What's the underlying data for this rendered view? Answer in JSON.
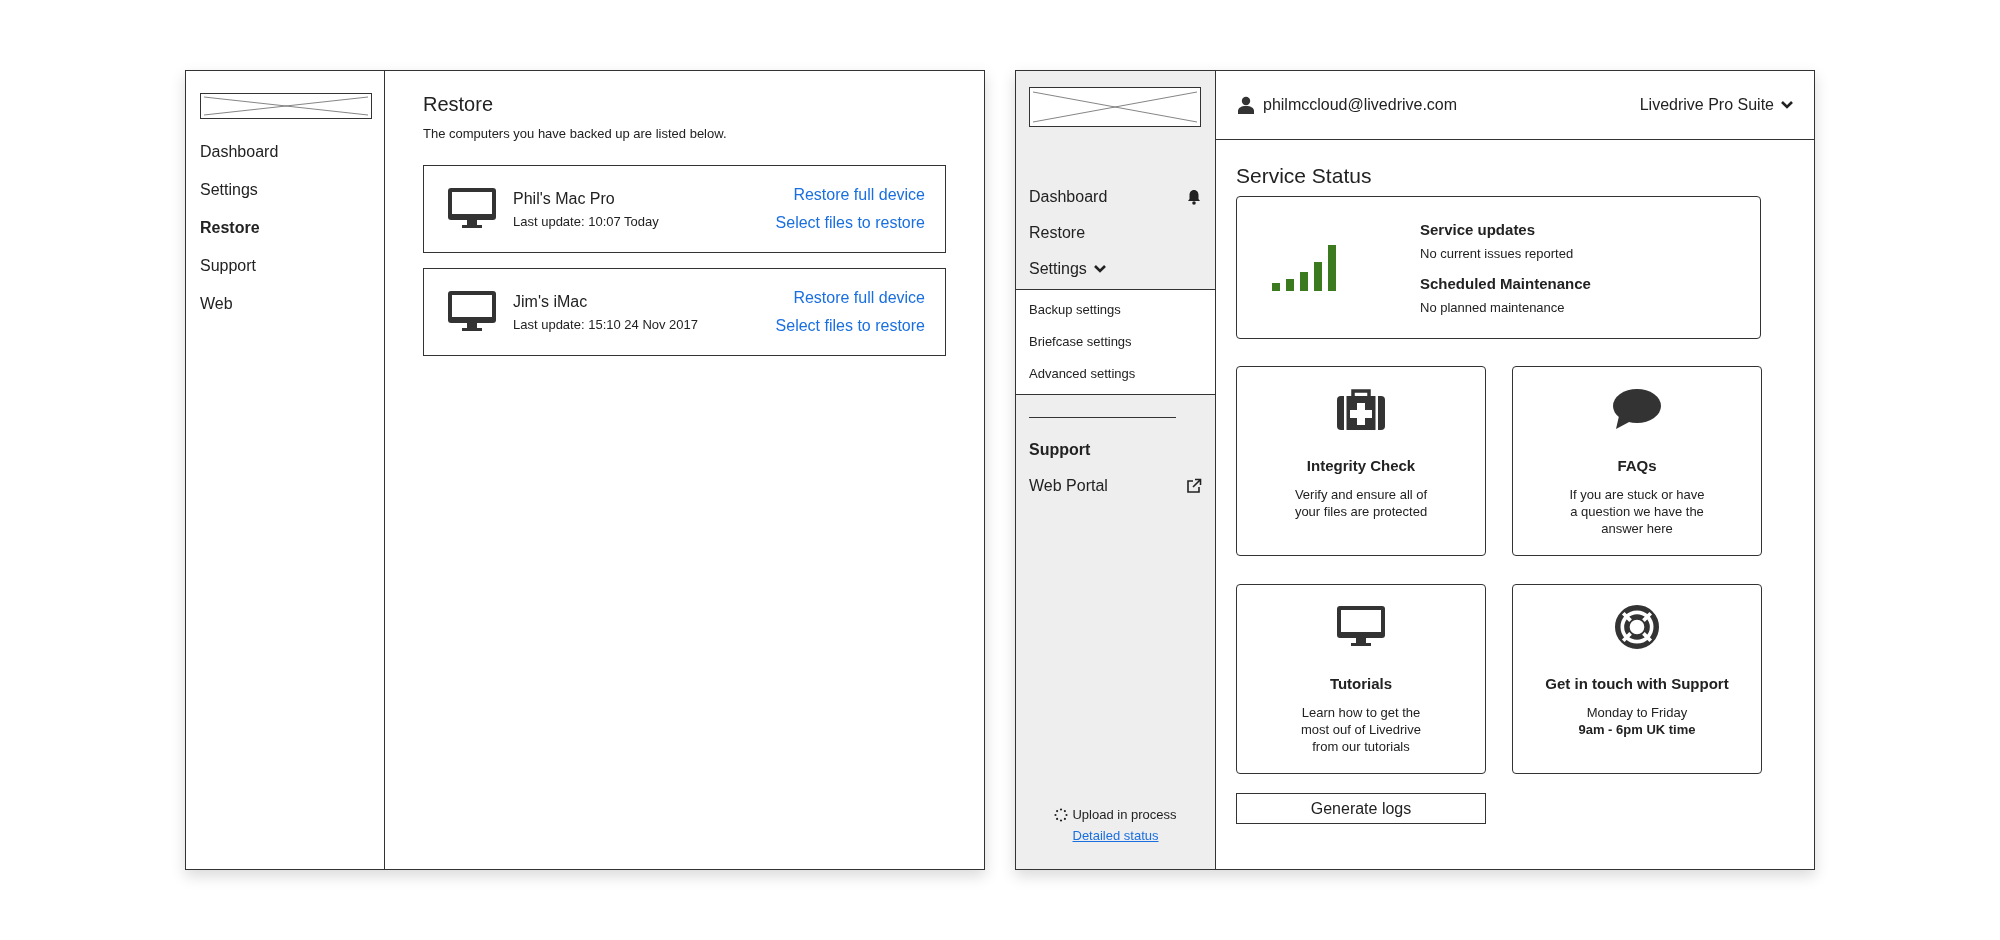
{
  "restore_window": {
    "sidebar": {
      "items": [
        {
          "label": "Dashboard",
          "selected": false
        },
        {
          "label": "Settings",
          "selected": false
        },
        {
          "label": "Restore",
          "selected": true
        },
        {
          "label": "Support",
          "selected": false
        },
        {
          "label": "Web",
          "selected": false
        }
      ]
    },
    "title": "Restore",
    "subtitle": "The computers you have backed up are listed below.",
    "devices": [
      {
        "name": "Phil's Mac Pro",
        "last_update": "Last update: 10:07 Today",
        "actions": [
          "Restore full device",
          "Select files to restore"
        ]
      },
      {
        "name": "Jim's iMac",
        "last_update": "Last update: 15:10 24 Nov 2017",
        "actions": [
          "Restore full device",
          "Select files to restore"
        ]
      }
    ]
  },
  "dashboard_window": {
    "sidebar": {
      "items": [
        {
          "label": "Dashboard",
          "kind": "alert",
          "selected": false
        },
        {
          "label": "Restore",
          "kind": "plain",
          "selected": false
        },
        {
          "label": "Settings",
          "kind": "group",
          "selected": false,
          "expanded": true,
          "children": [
            {
              "label": "Backup settings"
            },
            {
              "label": "Briefcase settings"
            },
            {
              "label": "Advanced settings"
            }
          ]
        },
        {
          "label": "Support",
          "kind": "plain",
          "selected": true
        },
        {
          "label": "Web Portal",
          "kind": "external",
          "selected": false
        }
      ],
      "upload_status": "Upload in process",
      "status_link": "Detailed status"
    },
    "header": {
      "user": "philmccloud@livedrive.com",
      "product": "Livedrive Pro Suite"
    },
    "title": "Service Status",
    "status_card": {
      "sections": [
        {
          "heading": "Service updates",
          "text": "No current issues reported"
        },
        {
          "heading": "Scheduled Maintenance",
          "text": "No planned maintenance"
        }
      ]
    },
    "tiles": [
      {
        "kind": "firstaid",
        "title": "Integrity Check",
        "lines": [
          "Verify and ensure all of",
          "your files are protected"
        ]
      },
      {
        "kind": "chat",
        "title": "FAQs",
        "lines": [
          "If you are stuck or have",
          "a question we have the",
          "answer here"
        ]
      },
      {
        "kind": "monitor",
        "title": "Tutorials",
        "lines": [
          "Learn how to get the",
          "most ouf of Livedrive",
          "from our tutorials"
        ]
      },
      {
        "kind": "lifebuoy",
        "title": "Get in touch with Support",
        "lines": [
          "Monday to Friday",
          "**9am - 6pm UK time**"
        ]
      }
    ],
    "button": "Generate logs"
  }
}
